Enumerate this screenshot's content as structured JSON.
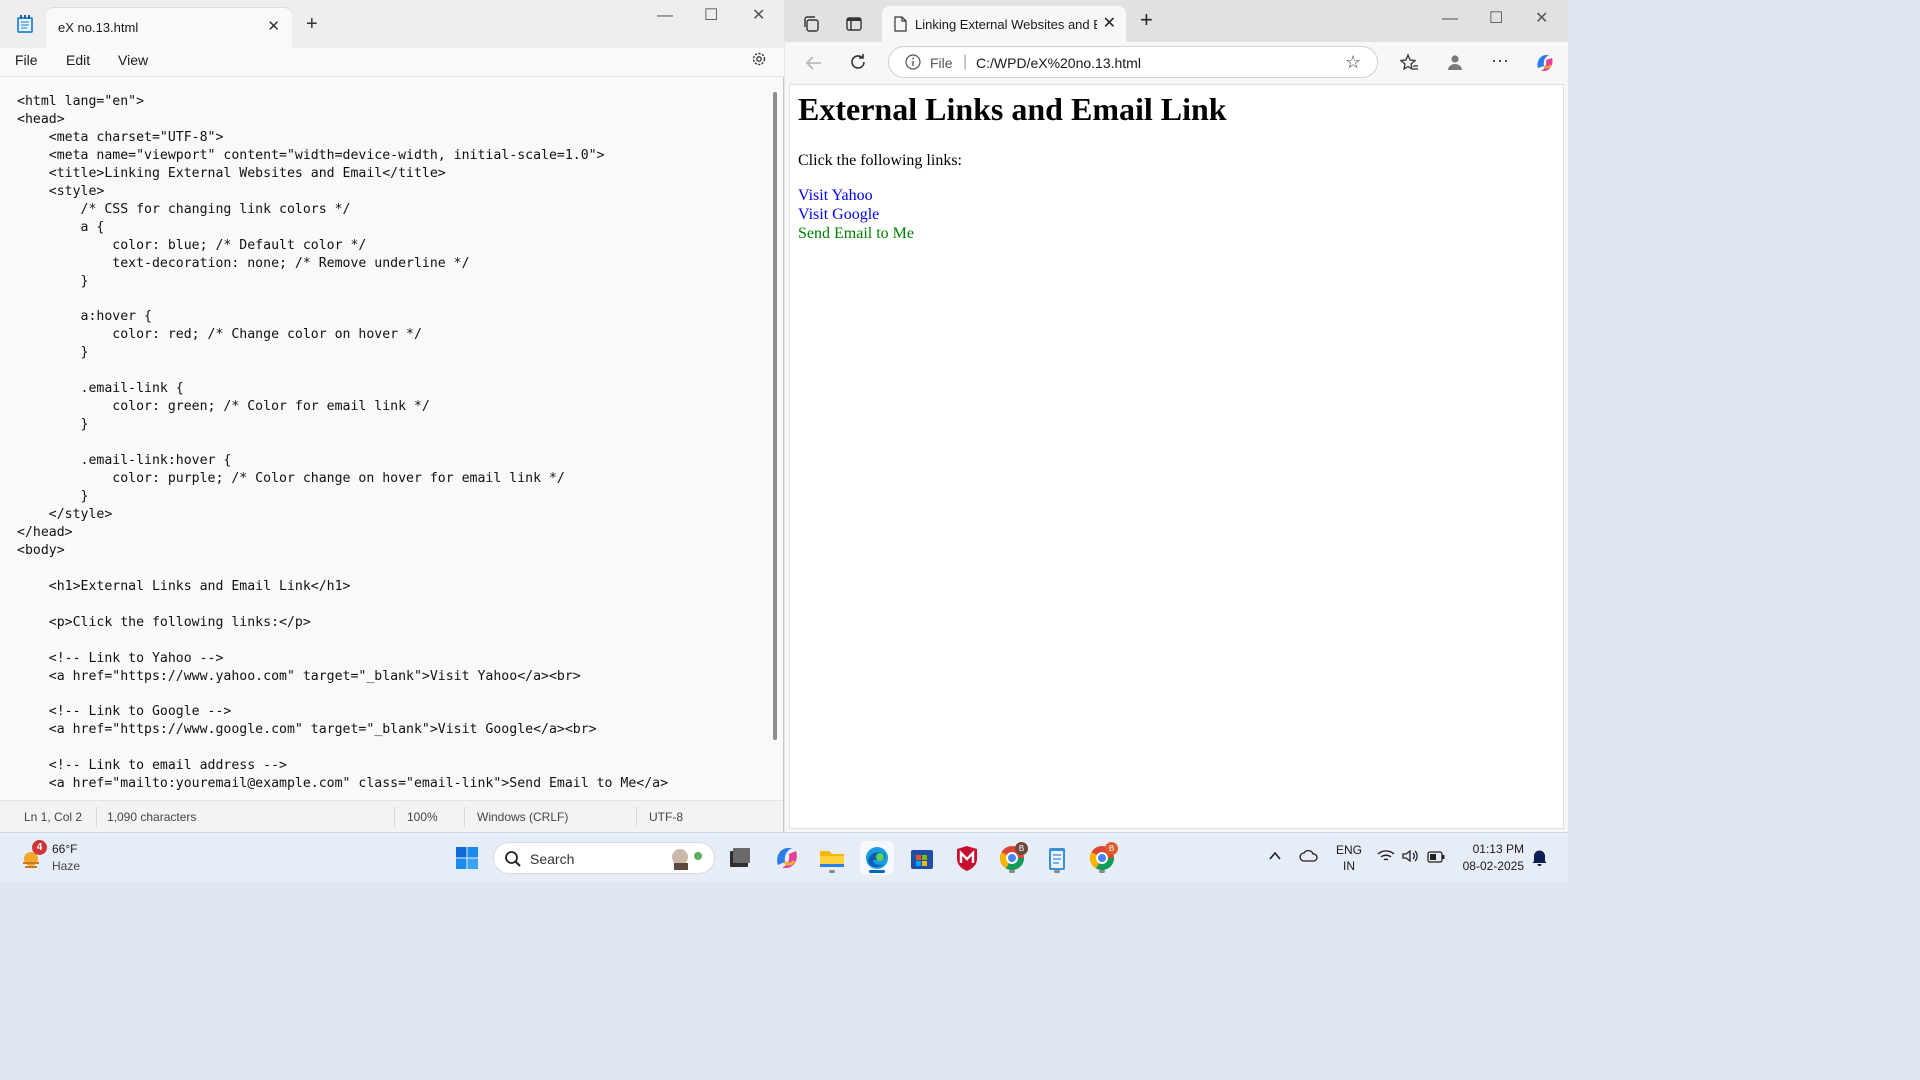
{
  "notepad": {
    "tab_title": "eX no.13.html",
    "menu": [
      "File",
      "Edit",
      "View"
    ],
    "code_lines": [
      "<html lang=\"en\">",
      "<head>",
      "    <meta charset=\"UTF-8\">",
      "    <meta name=\"viewport\" content=\"width=device-width, initial-scale=1.0\">",
      "    <title>Linking External Websites and Email</title>",
      "    <style>",
      "        /* CSS for changing link colors */",
      "        a {",
      "            color: blue; /* Default color */",
      "            text-decoration: none; /* Remove underline */",
      "        }",
      "",
      "        a:hover {",
      "            color: red; /* Change color on hover */",
      "        }",
      "",
      "        .email-link {",
      "            color: green; /* Color for email link */",
      "        }",
      "",
      "        .email-link:hover {",
      "            color: purple; /* Color change on hover for email link */",
      "        }",
      "    </style>",
      "</head>",
      "<body>",
      "",
      "    <h1>External Links and Email Link</h1>",
      "",
      "    <p>Click the following links:</p>",
      "",
      "    <!-- Link to Yahoo -->",
      "    <a href=\"https://www.yahoo.com\" target=\"_blank\">Visit Yahoo</a><br>",
      "",
      "    <!-- Link to Google -->",
      "    <a href=\"https://www.google.com\" target=\"_blank\">Visit Google</a><br>",
      "",
      "    <!-- Link to email address -->",
      "    <a href=\"mailto:youremail@example.com\" class=\"email-link\">Send Email to Me</a>"
    ],
    "status": {
      "position": "Ln 1, Col 2",
      "characters": "1,090 characters",
      "zoom": "100%",
      "line_ending": "Windows (CRLF)",
      "encoding": "UTF-8"
    }
  },
  "browser": {
    "tab_title": "Linking External Websites and Em",
    "address_label": "File",
    "address_url": "C:/WPD/eX%20no.13.html",
    "page": {
      "heading": "External Links and Email Link",
      "paragraph": "Click the following links:",
      "links": [
        {
          "text": "Visit Yahoo",
          "color": "#0000ee"
        },
        {
          "text": "Visit Google",
          "color": "#0000ee"
        },
        {
          "text": "Send Email to Me",
          "color": "#008000"
        }
      ]
    }
  },
  "taskbar": {
    "weather_temp": "66°F",
    "weather_desc": "Haze",
    "weather_badge": "4",
    "search_label": "Search",
    "apps": [
      "task-view",
      "copilot",
      "file-explorer",
      "edge",
      "microsoft-store",
      "mcafee",
      "chrome-profile-1",
      "notepad",
      "chrome-profile-2"
    ],
    "lang_top": "ENG",
    "lang_bottom": "IN",
    "time": "01:13 PM",
    "date": "08-02-2025",
    "chrome_badge_1": "B",
    "chrome_badge_2": "B"
  },
  "colors": {
    "accent": "#0067c0",
    "link_blue": "#0000ee",
    "link_green": "#008000"
  }
}
